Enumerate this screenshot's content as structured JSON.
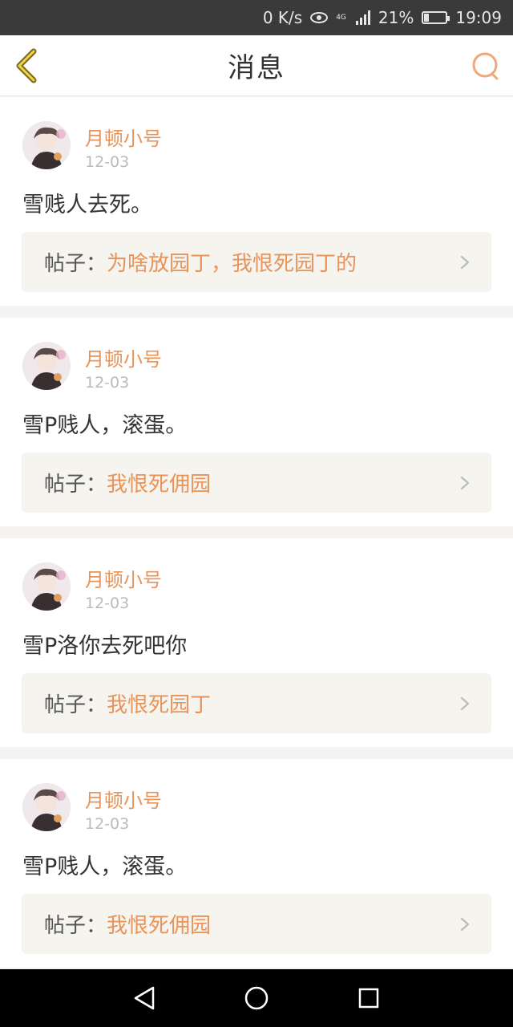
{
  "status_bar": {
    "speed": "0 K/s",
    "network": "4G",
    "battery_percent": "21%",
    "battery_level": 0.21,
    "time": "19:09"
  },
  "header": {
    "title": "消息",
    "back_icon": "chevron-left-icon",
    "search_icon": "search-icon"
  },
  "colors": {
    "accent": "#e8935a",
    "status_bar_bg": "#3a3a3a",
    "card_bg": "#ffffff",
    "post_box_bg": "#f6f4ee"
  },
  "messages": [
    {
      "username": "月顿小号",
      "date": "12-03",
      "text": "雪贱人去死。",
      "post_prefix": "帖子：",
      "post_title": "为啥放园丁，我恨死园丁的"
    },
    {
      "username": "月顿小号",
      "date": "12-03",
      "text": "雪P贱人，滚蛋。",
      "post_prefix": "帖子：",
      "post_title": "我恨死佣园"
    },
    {
      "username": "月顿小号",
      "date": "12-03",
      "text": "雪P洛你去死吧你",
      "post_prefix": "帖子：",
      "post_title": "我恨死园丁"
    },
    {
      "username": "月顿小号",
      "date": "12-03",
      "text": "雪P贱人，滚蛋。",
      "post_prefix": "帖子：",
      "post_title": "我恨死佣园"
    }
  ],
  "nav_bar": {
    "back": "triangle-back-icon",
    "home": "circle-home-icon",
    "recents": "square-recents-icon"
  }
}
